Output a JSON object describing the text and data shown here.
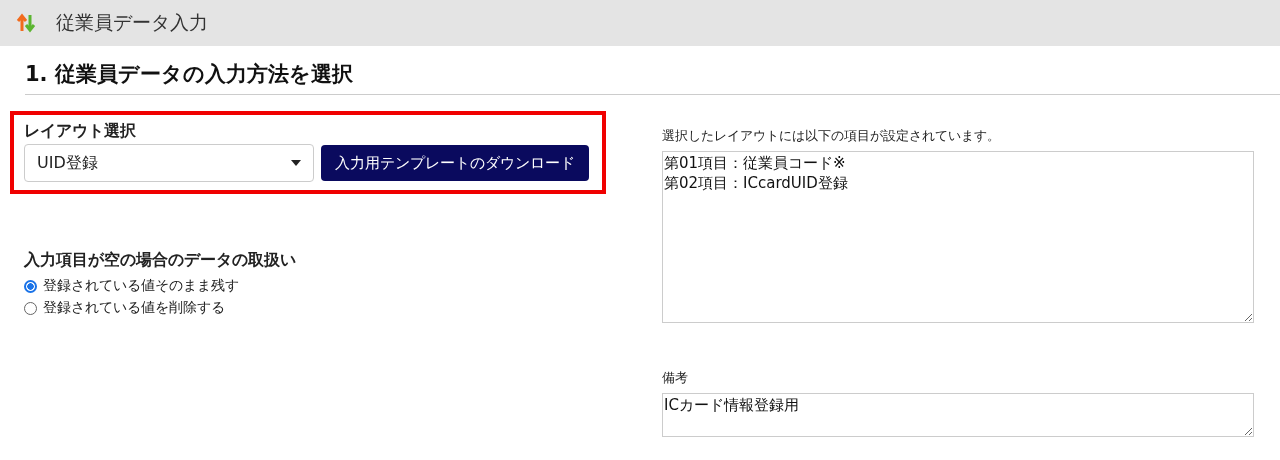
{
  "window": {
    "title": "従業員データ入力"
  },
  "section": {
    "heading": "1. 従業員データの入力方法を選択"
  },
  "layout_select": {
    "label": "レイアウト選択",
    "value": "UID登録",
    "highlighted": true,
    "button": "入力用テンプレートのダウンロード"
  },
  "empty_handling": {
    "label": "入力項目が空の場合のデータの取扱い",
    "options": [
      {
        "label": "登録されている値そのまま残す",
        "selected": true
      },
      {
        "label": "登録されている値を削除する",
        "selected": false
      }
    ]
  },
  "layout_items": {
    "label": "選択したレイアウトには以下の項目が設定されています。",
    "lines": [
      "第01項目：従業員コード※",
      "第02項目：ICcardUID登録"
    ]
  },
  "remarks": {
    "label": "備考",
    "value": "ICカード情報登録用"
  }
}
